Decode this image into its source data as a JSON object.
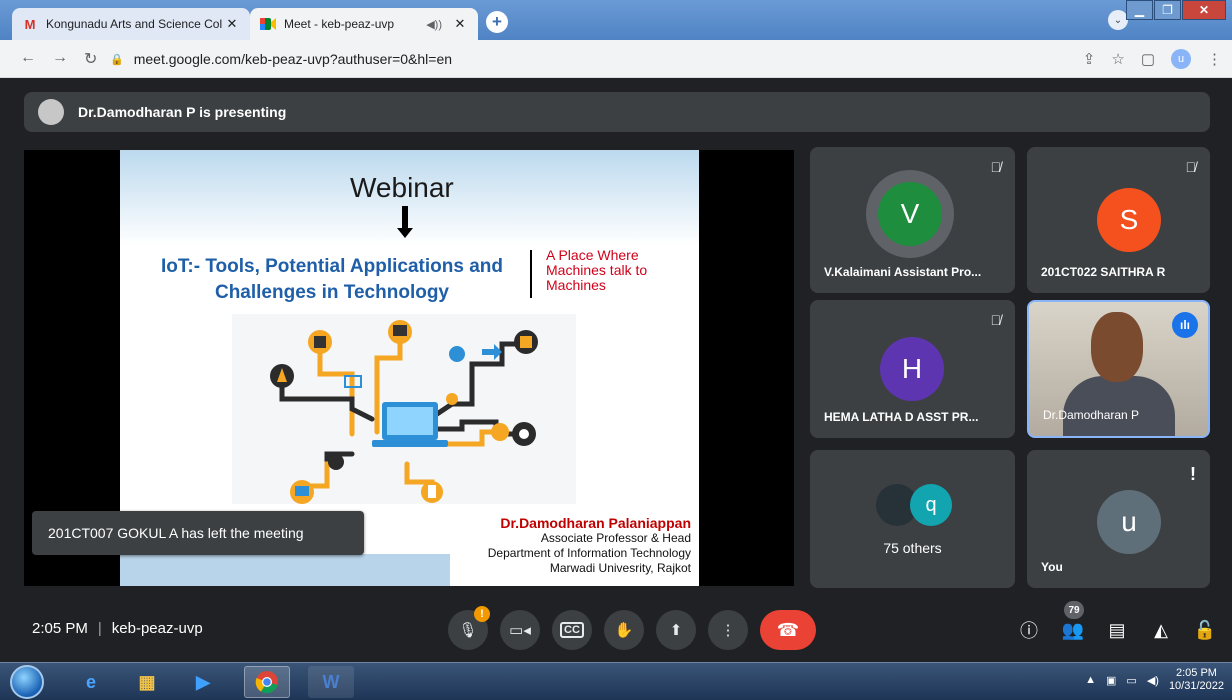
{
  "browser": {
    "tabs": [
      {
        "title": "Kongunadu Arts and Science Col",
        "icon": "gmail-icon",
        "active": false
      },
      {
        "title": "Meet - keb-peaz-uvp",
        "icon": "meet-icon",
        "active": true
      }
    ],
    "new_tab_label": "+",
    "url": "meet.google.com/keb-peaz-uvp?authuser=0&hl=en",
    "profile_initial": "u"
  },
  "meet": {
    "presenting_banner": "Dr.Damodharan P is presenting",
    "slide": {
      "heading": "Webinar",
      "title_line1": "IoT:- Tools, Potential Applications and",
      "title_line2": "Challenges in Technology",
      "tagline_line1": "A Place Where",
      "tagline_line2": "Machines talk to",
      "tagline_line3": "Machines",
      "presenter_name": "Dr.Damodharan Palaniappan",
      "presenter_role": "Associate Professor & Head",
      "presenter_dept": "Department of Information Technology",
      "presenter_univ": "Marwadi Univesrity, Rajkot"
    },
    "toast": "201CT007 GOKUL A has left the meeting",
    "participants": [
      {
        "name": "V.Kalaimani Assistant Pro...",
        "initial": "V",
        "color": "#1e8e3e",
        "muted": true
      },
      {
        "name": "201CT022 SAITHRA R",
        "initial": "S",
        "color": "#f4511e",
        "muted": true
      },
      {
        "name": "HEMA LATHA D ASST PR...",
        "initial": "H",
        "color": "#5e35b1",
        "muted": true
      },
      {
        "name": "Dr.Damodharan P",
        "initial": "",
        "color": "",
        "muted": false,
        "speaking": true
      },
      {
        "name": "75 others",
        "initial": "q",
        "color": "#12a4af"
      },
      {
        "name": "You",
        "initial": "u",
        "color": "#5f6f7a"
      }
    ],
    "time": "2:05 PM",
    "meeting_code": "keb-peaz-uvp",
    "participant_count": "79",
    "controls": [
      "mic-icon",
      "camera-icon",
      "captions-icon",
      "raise-hand-icon",
      "present-icon",
      "more-options-icon",
      "end-call-icon"
    ],
    "alert_mark": "!"
  },
  "taskbar": {
    "time": "2:05 PM",
    "date": "10/31/2022"
  }
}
